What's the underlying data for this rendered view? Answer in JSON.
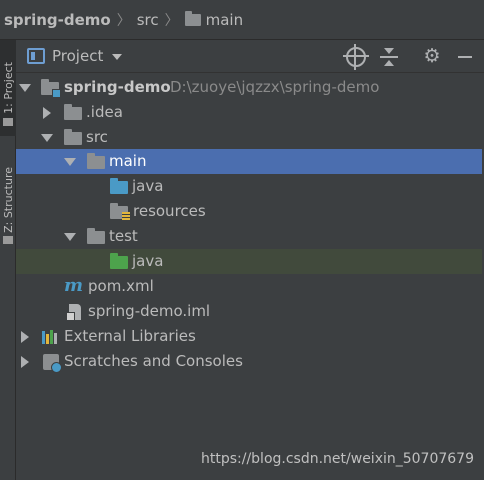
{
  "breadcrumb": {
    "items": [
      "spring-demo",
      "src",
      "main"
    ]
  },
  "side_strip": {
    "project_tab": "1: Project",
    "structure_tab": "Z: Structure"
  },
  "tool_window": {
    "title": "Project",
    "actions": [
      "locate-icon",
      "collapse-all-icon",
      "gear-icon",
      "minimize-icon"
    ]
  },
  "tree": {
    "root": {
      "label": "spring-demo",
      "path": "D:\\zuoye\\jqzzx\\spring-demo"
    },
    "idea": "idea",
    "src": "src",
    "main": "main",
    "main_java": "java",
    "resources": "resources",
    "test": "test",
    "test_java": "java",
    "pom": "pom.xml",
    "iml": "spring-demo.iml",
    "external_libraries": "External Libraries",
    "scratches": "Scratches and Consoles"
  },
  "colors": {
    "selection": "#4b6eaf",
    "highlight": "#414a3c",
    "folder_gray": "#8c8f91",
    "folder_blue": "#4a9ac6",
    "folder_green": "#4da34c"
  },
  "watermark": "https://blog.csdn.net/weixin_50707679"
}
